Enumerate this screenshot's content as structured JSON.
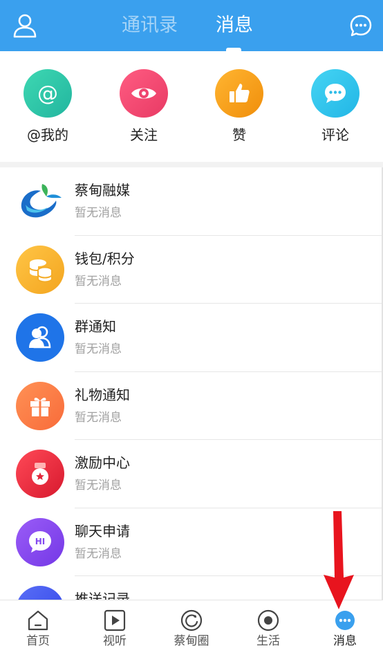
{
  "header": {
    "tabs": [
      {
        "label": "通讯录",
        "active": false
      },
      {
        "label": "消息",
        "active": true
      }
    ],
    "profile_icon": "person-icon",
    "chat_icon": "chat-bubble-icon",
    "bg_color": "#3aa0ee"
  },
  "quick_actions": [
    {
      "label": "@我的",
      "icon": "at-icon",
      "color": "#2fc7a6"
    },
    {
      "label": "关注",
      "icon": "eye-icon",
      "color": "#f24b74"
    },
    {
      "label": "赞",
      "icon": "thumbs-up-icon",
      "color": "#f7a21a"
    },
    {
      "label": "评论",
      "icon": "comment-icon",
      "color": "#36c6ee"
    }
  ],
  "messages": [
    {
      "title": "蔡甸融媒",
      "subtitle": "暂无消息",
      "icon": "caidian-logo-icon",
      "color": "#ffffff"
    },
    {
      "title": "钱包/积分",
      "subtitle": "暂无消息",
      "icon": "coins-icon",
      "color": "#f7b733"
    },
    {
      "title": "群通知",
      "subtitle": "暂无消息",
      "icon": "group-icon",
      "color": "#1f74e8"
    },
    {
      "title": "礼物通知",
      "subtitle": "暂无消息",
      "icon": "gift-icon",
      "color": "#ff7e47"
    },
    {
      "title": "激励中心",
      "subtitle": "暂无消息",
      "icon": "medal-icon",
      "color": "#ea2b3c"
    },
    {
      "title": "聊天申请",
      "subtitle": "暂无消息",
      "icon": "hi-chat-icon",
      "color": "#8448f0"
    },
    {
      "title": "推送记录",
      "subtitle": "",
      "icon": "push-icon",
      "color": "#3f57ee"
    }
  ],
  "bottom_nav": [
    {
      "label": "首页",
      "icon": "home-icon",
      "active": false
    },
    {
      "label": "视听",
      "icon": "play-icon",
      "active": false
    },
    {
      "label": "蔡甸圈",
      "icon": "circle-icon",
      "active": false
    },
    {
      "label": "生活",
      "icon": "disc-icon",
      "active": false
    },
    {
      "label": "消息",
      "icon": "message-dots-icon",
      "active": true
    }
  ],
  "accent_color": "#3aa0ee",
  "annotation_color": "#e8141e"
}
